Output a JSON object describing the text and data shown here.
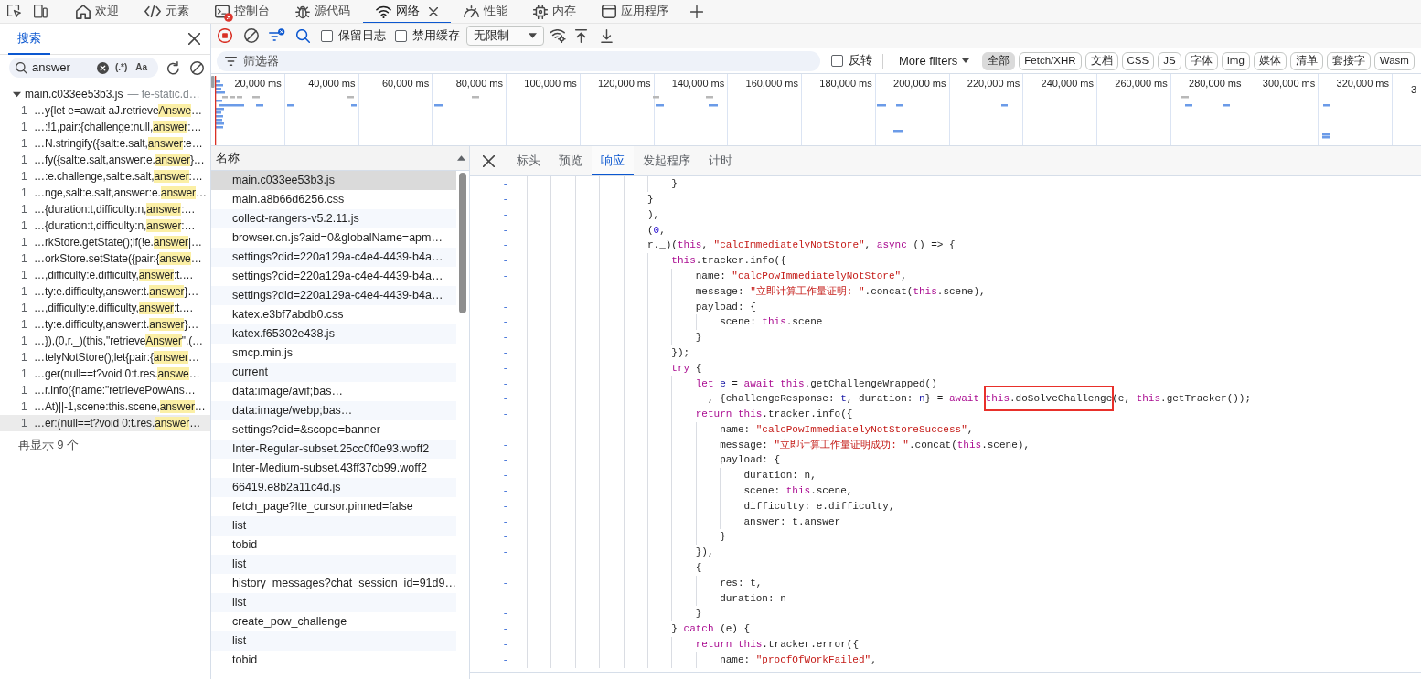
{
  "tab_bar": {
    "tabs": [
      {
        "label": "欢迎",
        "selected": false,
        "error": false
      },
      {
        "label": "元素",
        "selected": false,
        "error": false
      },
      {
        "label": "控制台",
        "selected": false,
        "error": true
      },
      {
        "label": "源代码",
        "selected": false,
        "error": false
      },
      {
        "label": "网络",
        "selected": true,
        "error": false
      },
      {
        "label": "性能",
        "selected": false,
        "error": false
      },
      {
        "label": "内存",
        "selected": false,
        "error": false
      },
      {
        "label": "应用程序",
        "selected": false,
        "error": false
      }
    ]
  },
  "search_panel": {
    "tabs": [
      {
        "label": "搜索",
        "selected": true
      }
    ],
    "search": {
      "value": "answer",
      "regex": {
        "label": "(.*)",
        "on": false
      },
      "match_case": {
        "label": "Aa",
        "on": false
      }
    },
    "results": {
      "file": "main.c033ee53b3.js",
      "origin": "— fe-static.d…",
      "expanded": true,
      "matches": [
        {
          "line": "1",
          "before": "…y{let e=await aJ.retrieve",
          "match": "Answe",
          "after": "…",
          "selected": false
        },
        {
          "line": "1",
          "before": "…:!1,pair:{challenge:null,",
          "match": "answer",
          "after": ":…",
          "selected": false
        },
        {
          "line": "1",
          "before": "…N.stringify({salt:e.salt,",
          "match": "answer",
          "after": ":e…",
          "selected": false
        },
        {
          "line": "1",
          "before": "…fy({salt:e.salt,answer:e.",
          "match": "answer",
          "after": "}…",
          "selected": false
        },
        {
          "line": "1",
          "before": "…:e.challenge,salt:e.salt,",
          "match": "answer",
          "after": ":…",
          "selected": false
        },
        {
          "line": "1",
          "before": "…nge,salt:e.salt,answer:e.",
          "match": "answer",
          "after": "…",
          "selected": false
        },
        {
          "line": "1",
          "before": "…{duration:t,difficulty:n,",
          "match": "answer",
          "after": ":…",
          "selected": false
        },
        {
          "line": "1",
          "before": "…{duration:t,difficulty:n,",
          "match": "answer",
          "after": ":…",
          "selected": false
        },
        {
          "line": "1",
          "before": "…rkStore.getState();if(!e.",
          "match": "answer",
          "after": "|…",
          "selected": false
        },
        {
          "line": "1",
          "before": "…orkStore.setState({pair:{",
          "match": "answe",
          "after": "…",
          "selected": false
        },
        {
          "line": "1",
          "before": "…,difficulty:e.difficulty,",
          "match": "answer",
          "after": ":t.…",
          "selected": false
        },
        {
          "line": "1",
          "before": "…ty:e.difficulty,answer:t.",
          "match": "answer",
          "after": "}…",
          "selected": false
        },
        {
          "line": "1",
          "before": "…,difficulty:e.difficulty,",
          "match": "answer",
          "after": ":t.…",
          "selected": false
        },
        {
          "line": "1",
          "before": "…ty:e.difficulty,answer:t.",
          "match": "answer",
          "after": "}…",
          "selected": false
        },
        {
          "line": "1",
          "before": "…}),(0,r._)(this,\"retrieve",
          "match": "Answer",
          "after": "\",(…",
          "selected": false
        },
        {
          "line": "1",
          "before": "…telyNotStore();let{pair:{",
          "match": "answer",
          "after": "…",
          "selected": false
        },
        {
          "line": "1",
          "before": "…ger(null==t?void 0:t.res.",
          "match": "answe",
          "after": "…",
          "selected": false
        },
        {
          "line": "1",
          "before": "…r.info({name:\"retrievePowAns…",
          "selected": false
        },
        {
          "line": "1",
          "before": "…At)||-1,scene:this.scene,",
          "match": "answer",
          "after": "…",
          "selected": false
        },
        {
          "line": "1",
          "before": "…er:(null==t?void 0:t.res.",
          "match": "answer",
          "after": "…",
          "selected": true
        }
      ]
    },
    "show_more": "再显示 9 个"
  },
  "network": {
    "toolbar": {
      "recording": true,
      "search_open": true,
      "preserve_log": {
        "label": "保留日志",
        "checked": false
      },
      "disable_cache": {
        "label": "禁用缓存",
        "checked": false
      },
      "throttling": "无限制"
    },
    "filter_bar": {
      "placeholder": "筛选器",
      "invert": {
        "label": "反转",
        "checked": false
      },
      "more_filters": "More filters",
      "types": [
        {
          "label": "全部",
          "selected": true
        },
        {
          "label": "Fetch/XHR",
          "selected": false
        },
        {
          "label": "文档",
          "selected": false
        },
        {
          "label": "CSS",
          "selected": false
        },
        {
          "label": "JS",
          "selected": false
        },
        {
          "label": "字体",
          "selected": false
        },
        {
          "label": "Img",
          "selected": false
        },
        {
          "label": "媒体",
          "selected": false
        },
        {
          "label": "清单",
          "selected": false
        },
        {
          "label": "套接字",
          "selected": false
        },
        {
          "label": "Wasm",
          "selected": false
        }
      ]
    },
    "overview": {
      "ticks": [
        "20,000 ms",
        "40,000 ms",
        "60,000 ms",
        "80,000 ms",
        "100,000 ms",
        "120,000 ms",
        "140,000 ms",
        "160,000 ms",
        "180,000 ms",
        "200,000 ms",
        "220,000 ms",
        "240,000 ms",
        "260,000 ms",
        "280,000 ms",
        "300,000 ms",
        "320,000 ms",
        "3"
      ]
    },
    "requests": {
      "column": "名称",
      "rows": [
        {
          "name": "main.c033ee53b3.js",
          "selected": true
        },
        {
          "name": "main.a8b66d6256.css",
          "selected": false
        },
        {
          "name": "collect-rangers-v5.2.11.js",
          "selected": false
        },
        {
          "name": "browser.cn.js?aid=0&globalName=apm…",
          "selected": false
        },
        {
          "name": "settings?did=220a129a-c4e4-4439-b4a…",
          "selected": false
        },
        {
          "name": "settings?did=220a129a-c4e4-4439-b4a…",
          "selected": false
        },
        {
          "name": "settings?did=220a129a-c4e4-4439-b4a…",
          "selected": false
        },
        {
          "name": "katex.e3bf7abdb0.css",
          "selected": false
        },
        {
          "name": "katex.f65302e438.js",
          "selected": false
        },
        {
          "name": "smcp.min.js",
          "selected": false
        },
        {
          "name": "current",
          "selected": false
        },
        {
          "name": "data:image/avif;bas…",
          "selected": false
        },
        {
          "name": "data:image/webp;bas…",
          "selected": false
        },
        {
          "name": "settings?did=&scope=banner",
          "selected": false
        },
        {
          "name": "Inter-Regular-subset.25cc0f0e93.woff2",
          "selected": false
        },
        {
          "name": "Inter-Medium-subset.43ff37cb99.woff2",
          "selected": false
        },
        {
          "name": "66419.e8b2a11c4d.js",
          "selected": false
        },
        {
          "name": "fetch_page?lte_cursor.pinned=false",
          "selected": false
        },
        {
          "name": "list",
          "selected": false
        },
        {
          "name": "tobid",
          "selected": false
        },
        {
          "name": "list",
          "selected": false
        },
        {
          "name": "history_messages?chat_session_id=91d9…",
          "selected": false
        },
        {
          "name": "list",
          "selected": false
        },
        {
          "name": "create_pow_challenge",
          "selected": false
        },
        {
          "name": "list",
          "selected": false
        },
        {
          "name": "tobid",
          "selected": false
        }
      ]
    },
    "detail": {
      "tabs": [
        {
          "label": "标头",
          "selected": false
        },
        {
          "label": "预览",
          "selected": false
        },
        {
          "label": "响应",
          "selected": true
        },
        {
          "label": "发起程序",
          "selected": false
        },
        {
          "label": "计时",
          "selected": false
        }
      ],
      "code_lines": [
        {
          "gutter": "-",
          "tokens": [
            {
              "text": "\t\t\t\t\t\t}",
              "kind": "plain"
            }
          ]
        },
        {
          "gutter": "-",
          "tokens": [
            {
              "text": "\t\t\t\t\t}",
              "kind": "plain"
            }
          ]
        },
        {
          "gutter": "-",
          "tokens": [
            {
              "text": "\t\t\t\t\t),",
              "kind": "plain"
            }
          ]
        },
        {
          "gutter": "-",
          "tokens": [
            {
              "text": "\t\t\t\t\t(",
              "kind": "plain"
            },
            {
              "text": "0",
              "kind": "number"
            },
            {
              "text": ",",
              "kind": "plain"
            }
          ]
        },
        {
          "gutter": "-",
          "tokens": [
            {
              "text": "\t\t\t\t\tr._)(",
              "kind": "plain"
            },
            {
              "text": "this",
              "kind": "keyword"
            },
            {
              "text": ", ",
              "kind": "plain"
            },
            {
              "text": "\"calcImmediatelyNotStore\"",
              "kind": "string"
            },
            {
              "text": ", ",
              "kind": "plain"
            },
            {
              "text": "async",
              "kind": "keyword"
            },
            {
              "text": " () => {",
              "kind": "plain"
            }
          ]
        },
        {
          "gutter": "-",
          "tokens": [
            {
              "text": "\t\t\t\t\t\tthis",
              "kind": "keyword"
            },
            {
              "text": ".tracker.info({",
              "kind": "plain"
            }
          ]
        },
        {
          "gutter": "-",
          "tokens": [
            {
              "text": "\t\t\t\t\t\t\tname: ",
              "kind": "plain"
            },
            {
              "text": "\"calcPowImmediatelyNotStore\"",
              "kind": "string"
            },
            {
              "text": ",",
              "kind": "plain"
            }
          ]
        },
        {
          "gutter": "-",
          "tokens": [
            {
              "text": "\t\t\t\t\t\t\tmessage: ",
              "kind": "plain"
            },
            {
              "text": "\"立即计算工作量证明: \"",
              "kind": "string"
            },
            {
              "text": ".concat(",
              "kind": "plain"
            },
            {
              "text": "this",
              "kind": "keyword"
            },
            {
              "text": ".scene),",
              "kind": "plain"
            }
          ]
        },
        {
          "gutter": "-",
          "tokens": [
            {
              "text": "\t\t\t\t\t\t\tpayload: {",
              "kind": "plain"
            }
          ]
        },
        {
          "gutter": "-",
          "tokens": [
            {
              "text": "\t\t\t\t\t\t\t\tscene: ",
              "kind": "plain"
            },
            {
              "text": "this",
              "kind": "keyword"
            },
            {
              "text": ".scene",
              "kind": "plain"
            }
          ]
        },
        {
          "gutter": "-",
          "tokens": [
            {
              "text": "\t\t\t\t\t\t\t}",
              "kind": "plain"
            }
          ]
        },
        {
          "gutter": "-",
          "tokens": [
            {
              "text": "\t\t\t\t\t\t});",
              "kind": "plain"
            }
          ]
        },
        {
          "gutter": "-",
          "tokens": [
            {
              "text": "\t\t\t\t\t\ttry",
              "kind": "keyword"
            },
            {
              "text": " {",
              "kind": "plain"
            }
          ]
        },
        {
          "gutter": "-",
          "tokens": [
            {
              "text": "\t\t\t\t\t\t\tlet",
              "kind": "keyword"
            },
            {
              "text": " e",
              "kind": "variable"
            },
            {
              "text": " = ",
              "kind": "plain"
            },
            {
              "text": "await ",
              "kind": "keyword"
            },
            {
              "text": "this",
              "kind": "keyword"
            },
            {
              "text": ".getChallengeWrapped()",
              "kind": "plain"
            }
          ]
        },
        {
          "gutter": "-",
          "tokens": [
            {
              "text": "\t\t\t\t\t\t\t  , {challengeResponse: ",
              "kind": "plain"
            },
            {
              "text": "t",
              "kind": "variable"
            },
            {
              "text": ", duration: ",
              "kind": "plain"
            },
            {
              "text": "n",
              "kind": "variable"
            },
            {
              "text": "} = ",
              "kind": "plain"
            },
            {
              "text": "await ",
              "kind": "keyword"
            },
            {
              "kind": "boxed",
              "tokens": [
                {
                  "text": "this",
                  "kind": "keyword"
                },
                {
                  "text": ".doSolveChallenge",
                  "kind": "plain"
                }
              ]
            },
            {
              "text": "(e, ",
              "kind": "plain"
            },
            {
              "text": "this",
              "kind": "keyword"
            },
            {
              "text": ".getTracker());",
              "kind": "plain"
            }
          ]
        },
        {
          "gutter": "-",
          "tokens": [
            {
              "text": "\t\t\t\t\t\t\treturn ",
              "kind": "keyword"
            },
            {
              "text": "this",
              "kind": "keyword"
            },
            {
              "text": ".tracker.info({",
              "kind": "plain"
            }
          ]
        },
        {
          "gutter": "-",
          "tokens": [
            {
              "text": "\t\t\t\t\t\t\t\tname: ",
              "kind": "plain"
            },
            {
              "text": "\"calcPowImmediatelyNotStoreSuccess\"",
              "kind": "string"
            },
            {
              "text": ",",
              "kind": "plain"
            }
          ]
        },
        {
          "gutter": "-",
          "tokens": [
            {
              "text": "\t\t\t\t\t\t\t\tmessage: ",
              "kind": "plain"
            },
            {
              "text": "\"立即计算工作量证明成功: \"",
              "kind": "string"
            },
            {
              "text": ".concat(",
              "kind": "plain"
            },
            {
              "text": "this",
              "kind": "keyword"
            },
            {
              "text": ".scene),",
              "kind": "plain"
            }
          ]
        },
        {
          "gutter": "-",
          "tokens": [
            {
              "text": "\t\t\t\t\t\t\t\tpayload: {",
              "kind": "plain"
            }
          ]
        },
        {
          "gutter": "-",
          "tokens": [
            {
              "text": "\t\t\t\t\t\t\t\t\tduration: n,",
              "kind": "plain"
            }
          ]
        },
        {
          "gutter": "-",
          "tokens": [
            {
              "text": "\t\t\t\t\t\t\t\t\tscene: ",
              "kind": "plain"
            },
            {
              "text": "this",
              "kind": "keyword"
            },
            {
              "text": ".scene,",
              "kind": "plain"
            }
          ]
        },
        {
          "gutter": "-",
          "tokens": [
            {
              "text": "\t\t\t\t\t\t\t\t\tdifficulty: e.difficulty,",
              "kind": "plain"
            }
          ]
        },
        {
          "gutter": "-",
          "tokens": [
            {
              "text": "\t\t\t\t\t\t\t\t\tanswer: t.answer",
              "kind": "plain"
            }
          ]
        },
        {
          "gutter": "-",
          "tokens": [
            {
              "text": "\t\t\t\t\t\t\t\t}",
              "kind": "plain"
            }
          ]
        },
        {
          "gutter": "-",
          "tokens": [
            {
              "text": "\t\t\t\t\t\t\t}),",
              "kind": "plain"
            }
          ]
        },
        {
          "gutter": "-",
          "tokens": [
            {
              "text": "\t\t\t\t\t\t\t{",
              "kind": "plain"
            }
          ]
        },
        {
          "gutter": "-",
          "tokens": [
            {
              "text": "\t\t\t\t\t\t\t\tres: t,",
              "kind": "plain"
            }
          ]
        },
        {
          "gutter": "-",
          "tokens": [
            {
              "text": "\t\t\t\t\t\t\t\tduration: n",
              "kind": "plain"
            }
          ]
        },
        {
          "gutter": "-",
          "tokens": [
            {
              "text": "\t\t\t\t\t\t\t}",
              "kind": "plain"
            }
          ]
        },
        {
          "gutter": "-",
          "tokens": [
            {
              "text": "\t\t\t\t\t\t} ",
              "kind": "plain"
            },
            {
              "text": "catch",
              "kind": "keyword"
            },
            {
              "text": " (e) {",
              "kind": "plain"
            }
          ]
        },
        {
          "gutter": "-",
          "tokens": [
            {
              "text": "\t\t\t\t\t\t\treturn ",
              "kind": "keyword"
            },
            {
              "text": "this",
              "kind": "keyword"
            },
            {
              "text": ".tracker.error({",
              "kind": "plain"
            }
          ]
        },
        {
          "gutter": "-",
          "tokens": [
            {
              "text": "\t\t\t\t\t\t\t\tname: ",
              "kind": "plain"
            },
            {
              "text": "\"proofOfWorkFailed\"",
              "kind": "string"
            },
            {
              "text": ",",
              "kind": "plain"
            }
          ]
        }
      ]
    }
  }
}
